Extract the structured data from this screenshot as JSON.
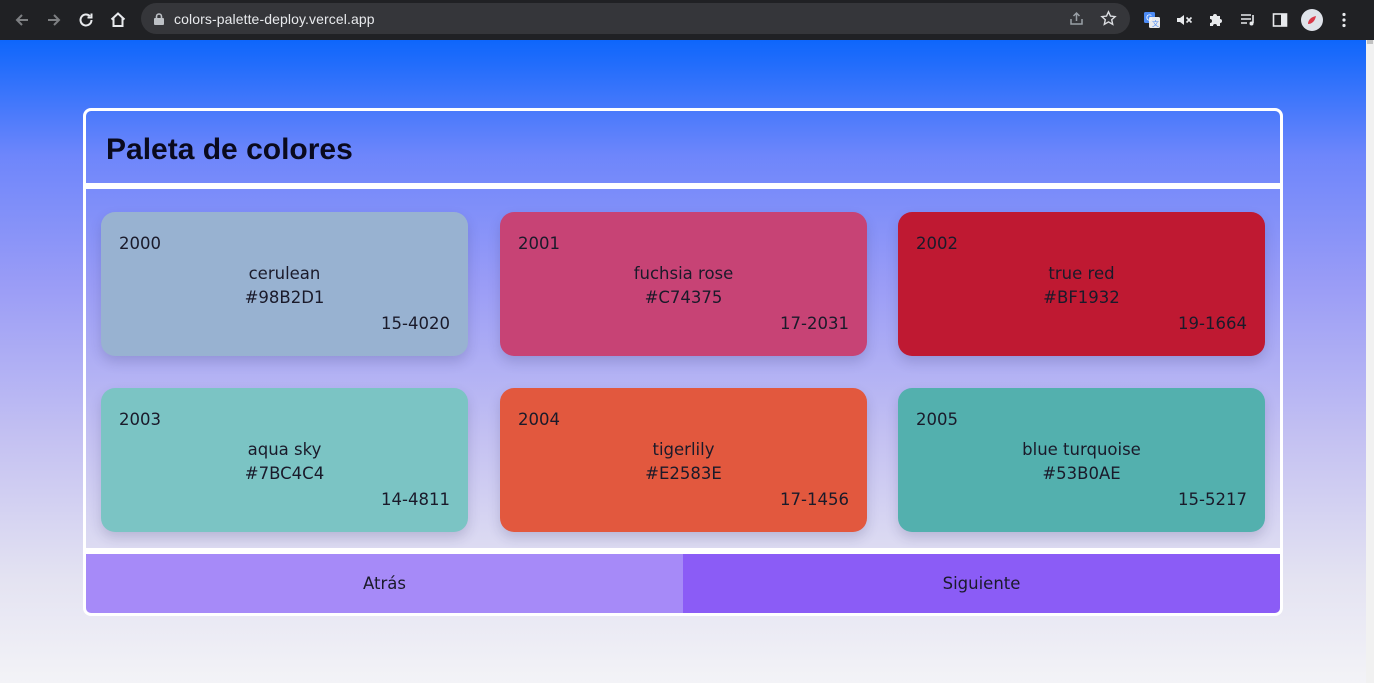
{
  "browser": {
    "url": "colors-palette-deploy.vercel.app",
    "icons": {
      "back": "arrow-left-icon",
      "forward": "arrow-right-icon",
      "reload": "reload-icon",
      "home": "home-icon",
      "lock": "lock-icon",
      "share": "share-icon",
      "bookmark": "star-icon",
      "translate": "translate-icon",
      "mute": "mute-icon",
      "extensions": "puzzle-icon",
      "media": "media-queue-icon",
      "sidepanel": "side-panel-icon",
      "profile": "avatar",
      "menu": "kebab-menu-icon"
    }
  },
  "page": {
    "title": "Paleta de colores",
    "colors": [
      {
        "year": "2000",
        "name": "cerulean",
        "hex": "#98B2D1",
        "code": "15-4020",
        "color": "#98B2D1"
      },
      {
        "year": "2001",
        "name": "fuchsia rose",
        "hex": "#C74375",
        "code": "17-2031",
        "color": "#C74375"
      },
      {
        "year": "2002",
        "name": "true red",
        "hex": "#BF1932",
        "code": "19-1664",
        "color": "#BF1932"
      },
      {
        "year": "2003",
        "name": "aqua sky",
        "hex": "#7BC4C4",
        "code": "14-4811",
        "color": "#7BC4C4"
      },
      {
        "year": "2004",
        "name": "tigerlily",
        "hex": "#E2583E",
        "code": "17-1456",
        "color": "#E2583E"
      },
      {
        "year": "2005",
        "name": "blue turquoise",
        "hex": "#53B0AE",
        "code": "15-5217",
        "color": "#53B0AE"
      }
    ],
    "back_label": "Atrás",
    "next_label": "Siguiente",
    "back_color": "#a68af8",
    "next_color": "#8b5cf6"
  }
}
